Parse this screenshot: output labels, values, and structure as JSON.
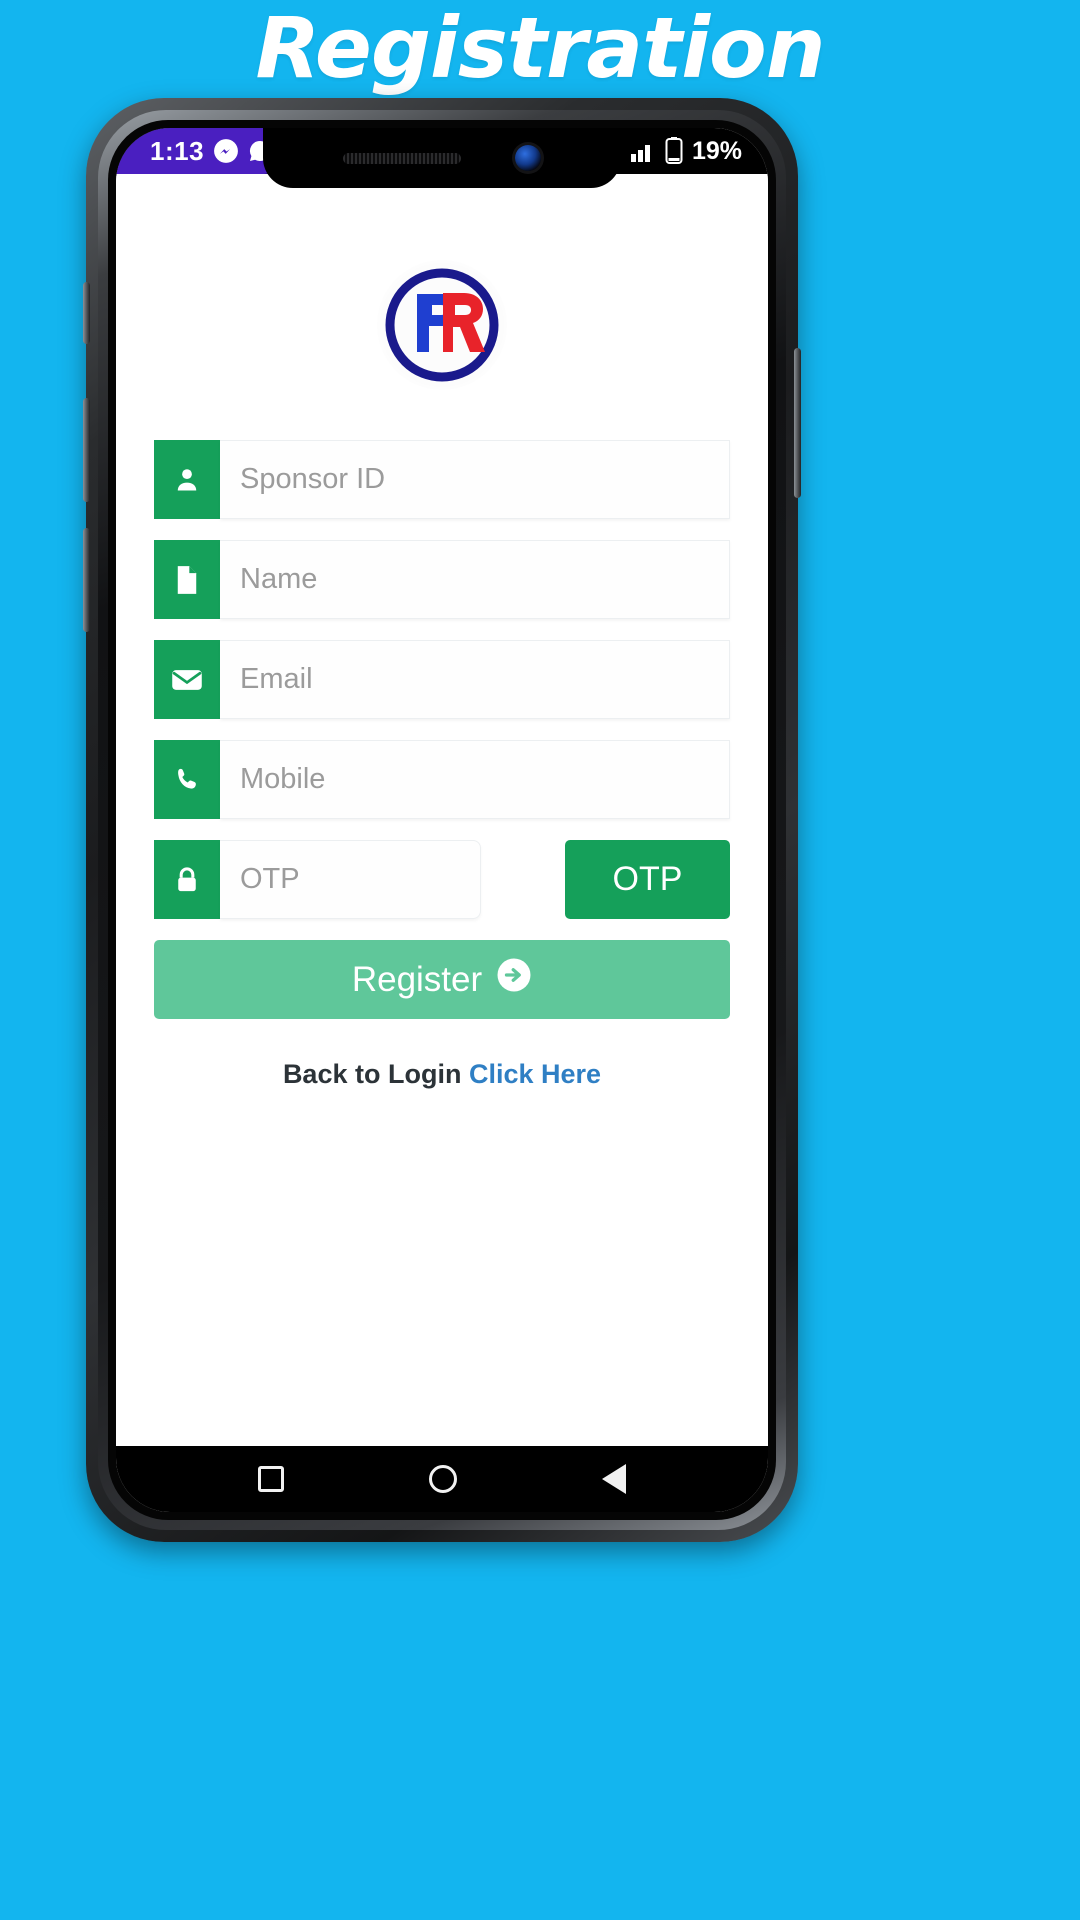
{
  "banner": {
    "title": "Registration",
    "bg_color": "#13b5ef",
    "text_color": "#ffffff"
  },
  "status_bar": {
    "time": "1:13",
    "left_icons": [
      "messenger-icon",
      "whatsapp-icon"
    ],
    "right_icons": [
      "signal-icon",
      "battery-icon"
    ],
    "battery": "19%",
    "accent_color": "#4a1fc0"
  },
  "app": {
    "logo": {
      "name": "pr-logo",
      "letters": "PR"
    },
    "fields": [
      {
        "icon": "person-icon",
        "placeholder": "Sponsor ID",
        "value": ""
      },
      {
        "icon": "document-icon",
        "placeholder": "Name",
        "value": ""
      },
      {
        "icon": "envelope-icon",
        "placeholder": "Email",
        "value": ""
      },
      {
        "icon": "phone-icon",
        "placeholder": "Mobile",
        "value": ""
      }
    ],
    "otp": {
      "icon": "lock-icon",
      "placeholder": "OTP",
      "value": "",
      "button_label": "OTP"
    },
    "register_button": {
      "label": "Register",
      "icon": "arrow-circle-right-icon",
      "color": "#5fc79a"
    },
    "footer": {
      "text": "Back to Login",
      "link": "Click Here",
      "link_color": "#2f7fc4"
    },
    "accent_green": "#15a05a"
  },
  "nav_bar": {
    "items": [
      "recents-square-icon",
      "home-circle-icon",
      "back-triangle-icon"
    ]
  }
}
